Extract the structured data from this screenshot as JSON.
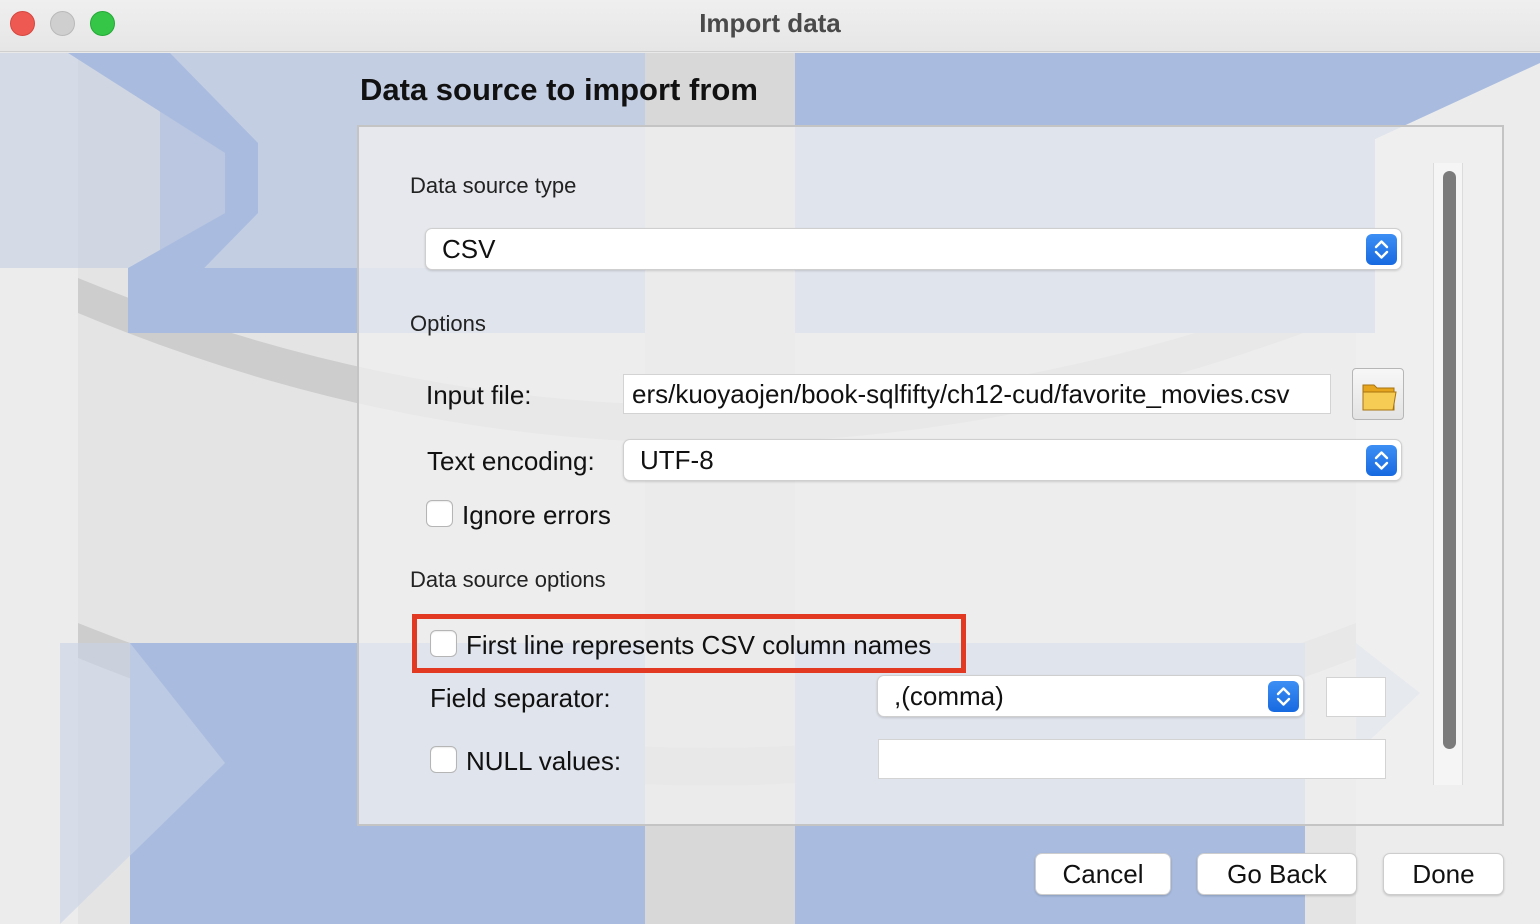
{
  "window": {
    "title": "Import data"
  },
  "page": {
    "heading": "Data source to import from"
  },
  "data_source_type": {
    "section_label": "Data source type",
    "selected": "CSV"
  },
  "options": {
    "section_label": "Options",
    "input_file_label": "Input file:",
    "input_file_value": "ers/kuoyaojen/book-sqlfifty/ch12-cud/favorite_movies.csv",
    "text_encoding_label": "Text encoding:",
    "text_encoding_value": "UTF-8",
    "ignore_errors_label": "Ignore errors",
    "ignore_errors_checked": false
  },
  "data_source_options": {
    "section_label": "Data source options",
    "first_line_label": "First line represents CSV column names",
    "first_line_checked": false,
    "field_separator_label": "Field separator:",
    "field_separator_value": ",(comma)",
    "null_values_label": "NULL values:",
    "null_values_checked": false,
    "null_values_value": ""
  },
  "buttons": {
    "cancel": "Cancel",
    "go_back": "Go Back",
    "done": "Done"
  },
  "icons": {
    "folder": "folder-icon",
    "stepper": "up-down-chevron-icon"
  },
  "colors": {
    "accent": "#1b6de3",
    "highlight_border": "#e23a22",
    "art_blue": "#a9bce0"
  }
}
